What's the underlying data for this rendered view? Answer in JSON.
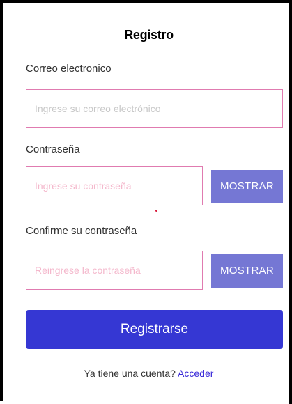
{
  "form": {
    "title": "Registro",
    "email": {
      "label": "Correo electronico",
      "placeholder": "Ingrese su correo electrónico"
    },
    "password": {
      "label": "Contraseña",
      "placeholder": "Ingrese su contraseña",
      "toggle_label": "MOSTRAR"
    },
    "confirm": {
      "label": "Confirme su contraseña",
      "placeholder": "Reingrese la contraseña",
      "toggle_label": "MOSTRAR"
    },
    "submit_label": "Registrarse",
    "footer": {
      "prompt": "Ya tiene una cuenta? ",
      "link": "Acceder"
    }
  },
  "colors": {
    "input_border": "#e07bb0",
    "toggle_button": "#7577d4",
    "primary_button": "#3537d3",
    "link": "#3a2ad8",
    "error_dot": "#d81b3c"
  }
}
